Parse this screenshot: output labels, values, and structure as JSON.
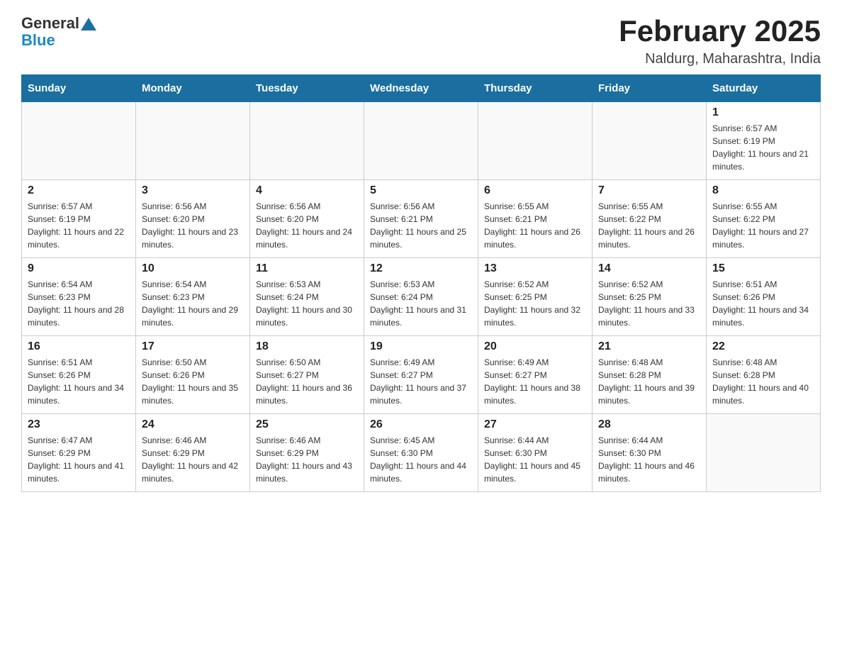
{
  "header": {
    "logo_general": "General",
    "logo_blue": "Blue",
    "title": "February 2025",
    "location": "Naldurg, Maharashtra, India"
  },
  "weekdays": [
    "Sunday",
    "Monday",
    "Tuesday",
    "Wednesday",
    "Thursday",
    "Friday",
    "Saturday"
  ],
  "weeks": [
    [
      {
        "day": "",
        "info": ""
      },
      {
        "day": "",
        "info": ""
      },
      {
        "day": "",
        "info": ""
      },
      {
        "day": "",
        "info": ""
      },
      {
        "day": "",
        "info": ""
      },
      {
        "day": "",
        "info": ""
      },
      {
        "day": "1",
        "info": "Sunrise: 6:57 AM\nSunset: 6:19 PM\nDaylight: 11 hours and 21 minutes."
      }
    ],
    [
      {
        "day": "2",
        "info": "Sunrise: 6:57 AM\nSunset: 6:19 PM\nDaylight: 11 hours and 22 minutes."
      },
      {
        "day": "3",
        "info": "Sunrise: 6:56 AM\nSunset: 6:20 PM\nDaylight: 11 hours and 23 minutes."
      },
      {
        "day": "4",
        "info": "Sunrise: 6:56 AM\nSunset: 6:20 PM\nDaylight: 11 hours and 24 minutes."
      },
      {
        "day": "5",
        "info": "Sunrise: 6:56 AM\nSunset: 6:21 PM\nDaylight: 11 hours and 25 minutes."
      },
      {
        "day": "6",
        "info": "Sunrise: 6:55 AM\nSunset: 6:21 PM\nDaylight: 11 hours and 26 minutes."
      },
      {
        "day": "7",
        "info": "Sunrise: 6:55 AM\nSunset: 6:22 PM\nDaylight: 11 hours and 26 minutes."
      },
      {
        "day": "8",
        "info": "Sunrise: 6:55 AM\nSunset: 6:22 PM\nDaylight: 11 hours and 27 minutes."
      }
    ],
    [
      {
        "day": "9",
        "info": "Sunrise: 6:54 AM\nSunset: 6:23 PM\nDaylight: 11 hours and 28 minutes."
      },
      {
        "day": "10",
        "info": "Sunrise: 6:54 AM\nSunset: 6:23 PM\nDaylight: 11 hours and 29 minutes."
      },
      {
        "day": "11",
        "info": "Sunrise: 6:53 AM\nSunset: 6:24 PM\nDaylight: 11 hours and 30 minutes."
      },
      {
        "day": "12",
        "info": "Sunrise: 6:53 AM\nSunset: 6:24 PM\nDaylight: 11 hours and 31 minutes."
      },
      {
        "day": "13",
        "info": "Sunrise: 6:52 AM\nSunset: 6:25 PM\nDaylight: 11 hours and 32 minutes."
      },
      {
        "day": "14",
        "info": "Sunrise: 6:52 AM\nSunset: 6:25 PM\nDaylight: 11 hours and 33 minutes."
      },
      {
        "day": "15",
        "info": "Sunrise: 6:51 AM\nSunset: 6:26 PM\nDaylight: 11 hours and 34 minutes."
      }
    ],
    [
      {
        "day": "16",
        "info": "Sunrise: 6:51 AM\nSunset: 6:26 PM\nDaylight: 11 hours and 34 minutes."
      },
      {
        "day": "17",
        "info": "Sunrise: 6:50 AM\nSunset: 6:26 PM\nDaylight: 11 hours and 35 minutes."
      },
      {
        "day": "18",
        "info": "Sunrise: 6:50 AM\nSunset: 6:27 PM\nDaylight: 11 hours and 36 minutes."
      },
      {
        "day": "19",
        "info": "Sunrise: 6:49 AM\nSunset: 6:27 PM\nDaylight: 11 hours and 37 minutes."
      },
      {
        "day": "20",
        "info": "Sunrise: 6:49 AM\nSunset: 6:27 PM\nDaylight: 11 hours and 38 minutes."
      },
      {
        "day": "21",
        "info": "Sunrise: 6:48 AM\nSunset: 6:28 PM\nDaylight: 11 hours and 39 minutes."
      },
      {
        "day": "22",
        "info": "Sunrise: 6:48 AM\nSunset: 6:28 PM\nDaylight: 11 hours and 40 minutes."
      }
    ],
    [
      {
        "day": "23",
        "info": "Sunrise: 6:47 AM\nSunset: 6:29 PM\nDaylight: 11 hours and 41 minutes."
      },
      {
        "day": "24",
        "info": "Sunrise: 6:46 AM\nSunset: 6:29 PM\nDaylight: 11 hours and 42 minutes."
      },
      {
        "day": "25",
        "info": "Sunrise: 6:46 AM\nSunset: 6:29 PM\nDaylight: 11 hours and 43 minutes."
      },
      {
        "day": "26",
        "info": "Sunrise: 6:45 AM\nSunset: 6:30 PM\nDaylight: 11 hours and 44 minutes."
      },
      {
        "day": "27",
        "info": "Sunrise: 6:44 AM\nSunset: 6:30 PM\nDaylight: 11 hours and 45 minutes."
      },
      {
        "day": "28",
        "info": "Sunrise: 6:44 AM\nSunset: 6:30 PM\nDaylight: 11 hours and 46 minutes."
      },
      {
        "day": "",
        "info": ""
      }
    ]
  ]
}
